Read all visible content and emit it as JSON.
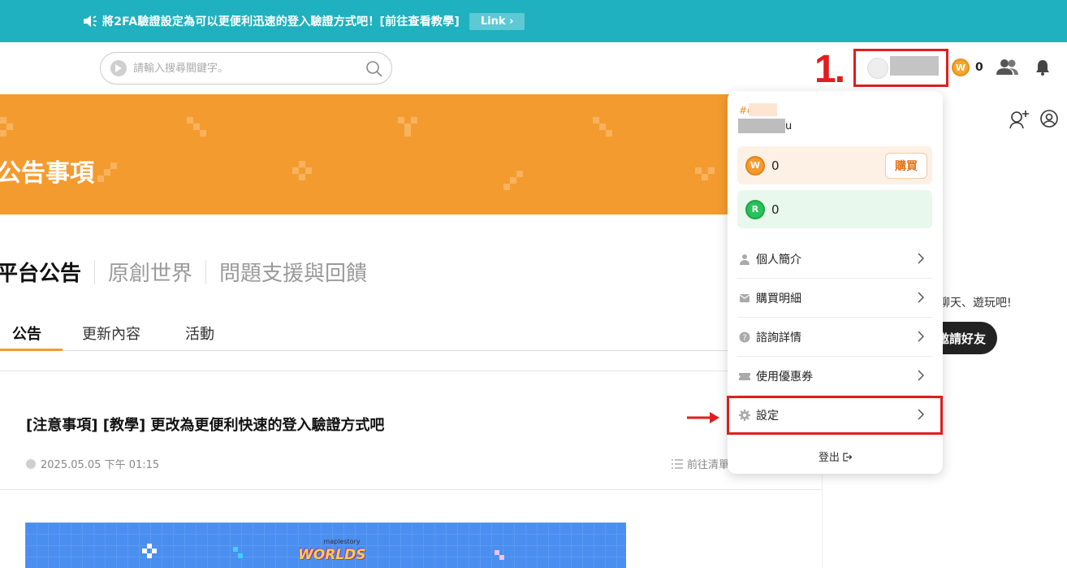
{
  "banner": {
    "message": "將2FA驗證設定為可以更便利迅速的登入驗證方式吧！[前往查看教學]",
    "link_label": "Link"
  },
  "header": {
    "search_placeholder": "請輸入搜尋關鍵字。",
    "coin_symbol": "W",
    "coin_balance": "0"
  },
  "annotation": {
    "step_label": "1."
  },
  "hero": {
    "title": "公告事項",
    "color": "#f49b2f"
  },
  "sections": [
    "平台公告",
    "原創世界",
    "問題支援與回饋"
  ],
  "tabs": [
    "公告",
    "更新內容",
    "活動"
  ],
  "post": {
    "title": "[注意事項] [教學] 更改為更便利快速的登入驗證方式吧",
    "date": "2025.05.05 下午 01:15",
    "goto_list": "前往清單",
    "image_logo_small": "maplestory",
    "image_logo": "WORLDS"
  },
  "right_panel": {
    "chat_text": "聊天、遊玩吧!",
    "invite_label": "邀請好友"
  },
  "dropdown": {
    "user_tag": "#q",
    "user_name_suffix": "u",
    "w_symbol": "W",
    "w_balance": "0",
    "buy_label": "購買",
    "r_symbol": "R",
    "r_balance": "0",
    "menu": [
      {
        "label": "個人簡介",
        "icon": "person-icon"
      },
      {
        "label": "購買明細",
        "icon": "receipt-icon"
      },
      {
        "label": "諮詢詳情",
        "icon": "question-icon"
      },
      {
        "label": "使用優惠券",
        "icon": "coupon-icon"
      },
      {
        "label": "設定",
        "icon": "gear-icon"
      }
    ],
    "logout_label": "登出"
  },
  "colors": {
    "banner": "#1fb1c0",
    "accent": "#f49b2f",
    "highlight": "#e01e1e"
  }
}
